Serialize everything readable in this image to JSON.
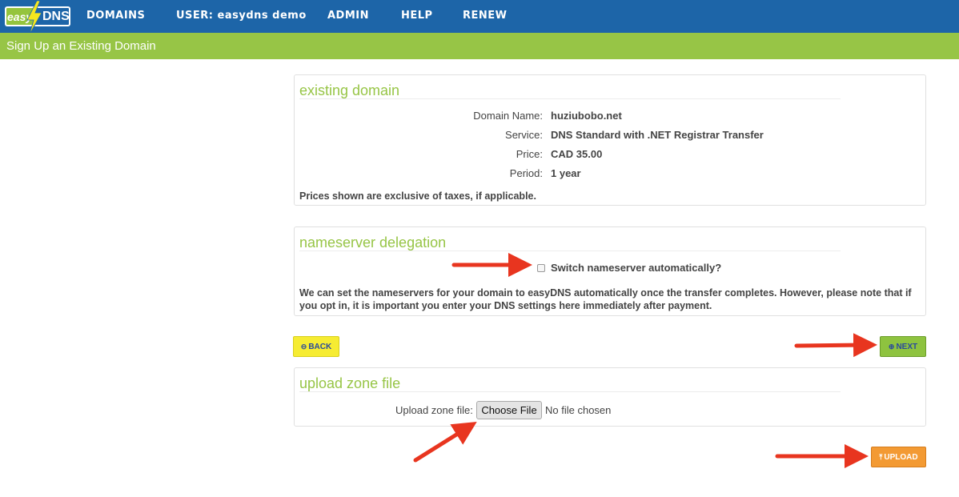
{
  "nav": {
    "logo_easy": "easy",
    "logo_dns": "DNS",
    "items": [
      "DOMAINS",
      "USER: easydns demo",
      "ADMIN",
      "HELP",
      "RENEW"
    ]
  },
  "page_title": "Sign Up an Existing Domain",
  "existing_domain": {
    "heading": "existing domain",
    "rows": [
      {
        "label": "Domain Name:",
        "value": "huziubobo.net"
      },
      {
        "label": "Service:",
        "value": "DNS Standard with .NET Registrar Transfer"
      },
      {
        "label": "Price:",
        "value": "CAD 35.00"
      },
      {
        "label": "Period:",
        "value": "1 year"
      }
    ],
    "note": "Prices shown are exclusive of taxes, if applicable."
  },
  "nameserver": {
    "heading": "nameserver delegation",
    "checkbox_label": "Switch nameserver automatically?",
    "note": "We can set the nameservers for your domain to easyDNS automatically once the transfer completes. However, please note that if you opt in, it is important you enter your DNS settings here immediately after payment."
  },
  "buttons": {
    "back": "BACK",
    "next": "NEXT",
    "upload": "UPLOAD"
  },
  "upload": {
    "heading": "upload zone file",
    "label": "Upload zone file:",
    "choose_button": "Choose File",
    "status": "No file chosen"
  },
  "colors": {
    "nav_blue": "#1d65a8",
    "brand_green": "#97c546",
    "back_yellow": "#f6ec32",
    "upload_orange": "#f39a33",
    "arrow_red": "#e8351f"
  }
}
